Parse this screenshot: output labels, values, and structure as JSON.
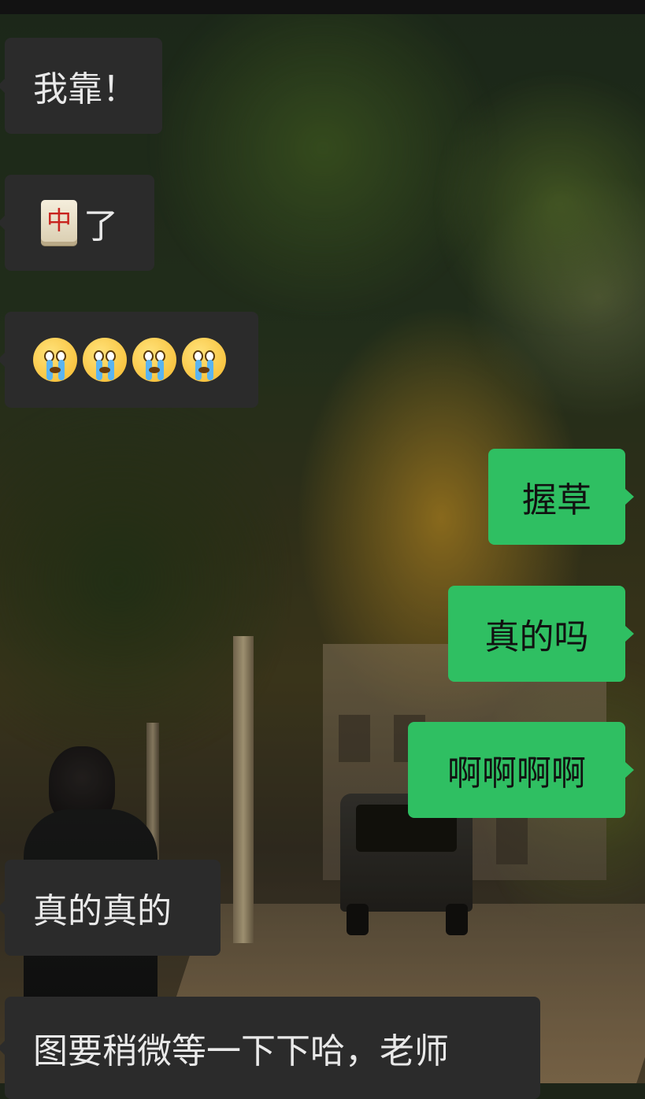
{
  "messages": [
    {
      "side": "left",
      "text": "我靠！"
    },
    {
      "side": "left",
      "text": "了",
      "emoji_before": "mahjong-red-dragon-tile",
      "emoji_char": "中"
    },
    {
      "side": "left",
      "emojis": [
        "crying-face-emoji",
        "crying-face-emoji",
        "crying-face-emoji",
        "crying-face-emoji"
      ]
    },
    {
      "side": "right",
      "text": "握草"
    },
    {
      "side": "right",
      "text": "真的吗"
    },
    {
      "side": "right",
      "text": "啊啊啊啊"
    },
    {
      "side": "left",
      "text": "真的真的"
    },
    {
      "side": "left",
      "text": "图要稍微等一下下哈，老师"
    }
  ],
  "colors": {
    "incoming_bubble": "#2b2b2b",
    "incoming_text": "#e9e9e9",
    "outgoing_bubble": "#2fbf62",
    "outgoing_text": "#111111",
    "top_bar": "#121212"
  }
}
